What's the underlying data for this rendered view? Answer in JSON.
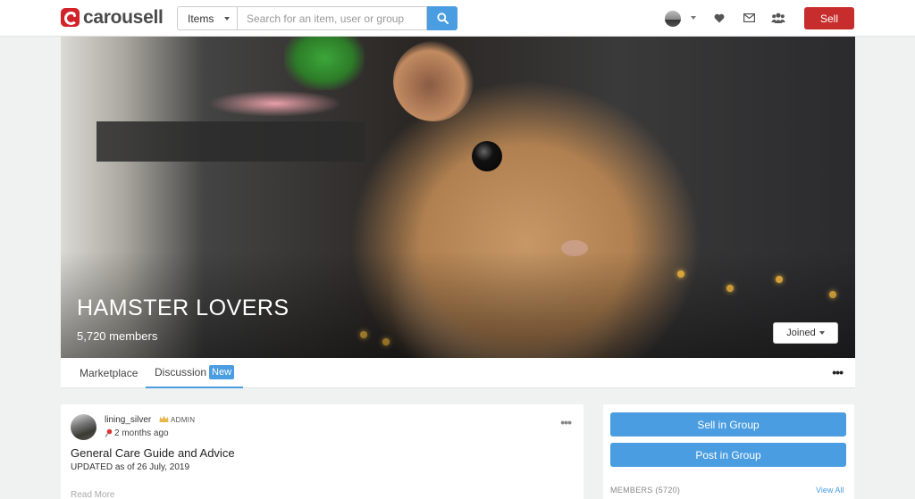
{
  "header": {
    "logo_text": "carousell",
    "search_scope": "Items",
    "search_placeholder": "Search for an item, user or group",
    "sell_label": "Sell"
  },
  "hero": {
    "group_name": "HAMSTER LOVERS",
    "member_count": "5,720 members",
    "joined_label": "Joined"
  },
  "tabs": {
    "marketplace": "Marketplace",
    "discussion": "Discussion",
    "new_badge": "New",
    "more": "•••"
  },
  "post": {
    "username": "lining_silver",
    "role": "ADMIN",
    "time": "2 months ago",
    "more": "•••",
    "title": "General Care Guide and Advice",
    "updated": "UPDATED as of 26 July, 2019",
    "read_more": "Read More"
  },
  "sidebar": {
    "sell_in_group": "Sell in Group",
    "post_in_group": "Post in Group",
    "members_label": "MEMBERS (5720)",
    "view_all": "View All"
  },
  "colors": {
    "brand_red": "#d2232a",
    "sell_red": "#c72d2d",
    "accent_blue": "#4a9de0"
  },
  "icons": [
    "logo-mark-icon",
    "search-icon",
    "heart-icon",
    "mail-icon",
    "groups-icon",
    "crown-icon",
    "pin-icon",
    "chevron-down-icon"
  ]
}
